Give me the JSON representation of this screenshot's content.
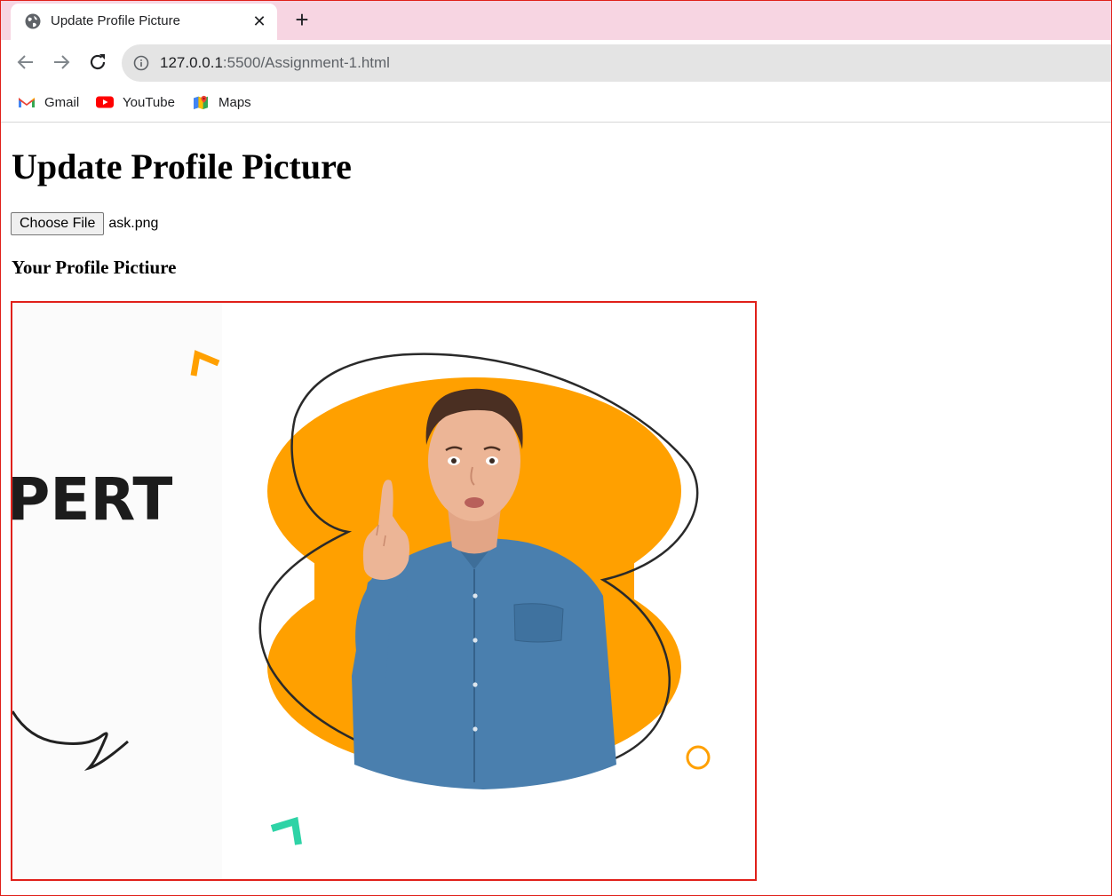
{
  "browser": {
    "tab_title": "Update Profile Picture",
    "tab_close_glyph": "✕",
    "new_tab_glyph": "+",
    "url_host": "127.0.0.1",
    "url_rest": ":5500/Assignment-1.html",
    "bookmarks": [
      {
        "label": "Gmail",
        "icon": "gmail-icon"
      },
      {
        "label": "YouTube",
        "icon": "youtube-icon"
      },
      {
        "label": "Maps",
        "icon": "maps-icon"
      }
    ]
  },
  "page": {
    "title": "Update Profile Picture",
    "file_button_label": "Choose File",
    "file_name": "ask.png",
    "subtitle": "Your Profile Pictiure",
    "image_text": "PERT"
  },
  "colors": {
    "tabstrip": "#f7d5e2",
    "accent_orange": "#ffa000",
    "accent_teal": "#2ed3a6",
    "frame_border": "#e0201a"
  }
}
